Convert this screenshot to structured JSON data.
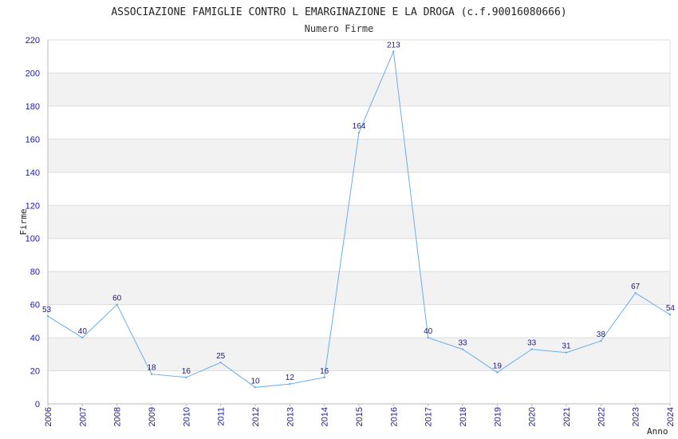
{
  "chart_data": {
    "type": "line",
    "title": "ASSOCIAZIONE FAMIGLIE CONTRO L EMARGINAZIONE E LA DROGA (c.f.90016080666)",
    "subtitle": "Numero Firme",
    "xlabel": "Anno",
    "ylabel": "Firme",
    "ylim": [
      0,
      220
    ],
    "yticks": [
      0,
      20,
      40,
      60,
      80,
      100,
      120,
      140,
      160,
      180,
      200,
      220
    ],
    "grid": true,
    "x": [
      "2006",
      "2007",
      "2008",
      "2009",
      "2010",
      "2011",
      "2012",
      "2013",
      "2014",
      "2015",
      "2016",
      "2017",
      "2018",
      "2019",
      "2020",
      "2021",
      "2022",
      "2023",
      "2024"
    ],
    "series": [
      {
        "values": [
          53,
          40,
          60,
          18,
          16,
          25,
          10,
          12,
          16,
          164,
          213,
          40,
          33,
          19,
          33,
          31,
          38,
          67,
          54
        ],
        "color": "#6aaee8"
      }
    ],
    "colors": {
      "band": "#f2f2f2",
      "grid": "#dddddd",
      "tick_text": "#1a1aa6",
      "label_text": "#1a1a80"
    }
  }
}
